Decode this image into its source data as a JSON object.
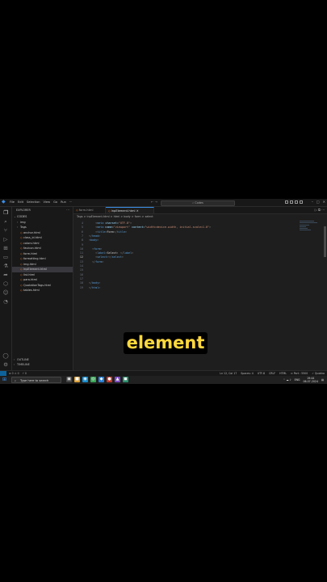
{
  "titlebar": {
    "menu": [
      "File",
      "Edit",
      "Selection",
      "View",
      "Go",
      "Run",
      "···"
    ],
    "search": "Codes",
    "nav": "← →"
  },
  "explorer": {
    "title": "EXPLORER",
    "root": "CODES",
    "items": [
      {
        "label": "img",
        "type": "folder",
        "indent": 1
      },
      {
        "label": "Tags",
        "type": "folder",
        "indent": 1
      },
      {
        "label": "anchor.html",
        "type": "file",
        "indent": 2
      },
      {
        "label": "class_id.html",
        "type": "file",
        "indent": 2
      },
      {
        "label": "colors.html",
        "type": "file",
        "indent": 2
      },
      {
        "label": "favicon.html",
        "type": "file",
        "indent": 2
      },
      {
        "label": "form.html",
        "type": "file",
        "indent": 2
      },
      {
        "label": "formatting.html",
        "type": "file",
        "indent": 2
      },
      {
        "label": "img.html",
        "type": "file",
        "indent": 2
      },
      {
        "label": "inpElement.html",
        "type": "file",
        "indent": 2,
        "selected": true
      },
      {
        "label": "list.html",
        "type": "file",
        "indent": 2
      },
      {
        "label": "para.html",
        "type": "file",
        "indent": 2
      },
      {
        "label": "QuotationTags.html",
        "type": "file",
        "indent": 2
      },
      {
        "label": "tables.html",
        "type": "file",
        "indent": 2
      }
    ],
    "outline": "OUTLINE",
    "timeline": "TIMELINE"
  },
  "tabs": [
    {
      "label": "form.html",
      "active": false
    },
    {
      "label": "inpElement.html",
      "active": true
    }
  ],
  "breadcrumb": "Tags > inpElement.html > html > body > form > select",
  "code_lines": [
    {
      "n": "4",
      "parts": [
        [
          "p",
          "    <"
        ],
        [
          "t",
          "meta"
        ],
        [
          "a",
          " charset"
        ],
        [
          "x",
          "="
        ],
        [
          "s",
          "\"UTF-8\""
        ],
        [
          "p",
          ">"
        ]
      ]
    },
    {
      "n": "5",
      "parts": [
        [
          "p",
          "    <"
        ],
        [
          "t",
          "meta"
        ],
        [
          "a",
          " name"
        ],
        [
          "x",
          "="
        ],
        [
          "s",
          "\"viewport\""
        ],
        [
          "a",
          " content"
        ],
        [
          "x",
          "="
        ],
        [
          "s",
          "\"width=device-width, initial-scale=1.0\""
        ],
        [
          "p",
          ">"
        ]
      ]
    },
    {
      "n": "6",
      "parts": [
        [
          "p",
          "    <"
        ],
        [
          "t",
          "title"
        ],
        [
          "p",
          ">"
        ],
        [
          "x",
          "Form"
        ],
        [
          "p",
          "</"
        ],
        [
          "t",
          "title"
        ],
        [
          "p",
          ">"
        ]
      ]
    },
    {
      "n": "7",
      "parts": [
        [
          "p",
          "</"
        ],
        [
          "t",
          "head"
        ],
        [
          "p",
          ">"
        ]
      ]
    },
    {
      "n": "8",
      "parts": [
        [
          "p",
          "<"
        ],
        [
          "t",
          "body"
        ],
        [
          "p",
          ">"
        ]
      ]
    },
    {
      "n": "9",
      "parts": [
        [
          "x",
          ""
        ]
      ]
    },
    {
      "n": "10",
      "parts": [
        [
          "p",
          "  <"
        ],
        [
          "t",
          "form"
        ],
        [
          "p",
          ">"
        ]
      ]
    },
    {
      "n": "11",
      "parts": [
        [
          "p",
          "    <"
        ],
        [
          "t",
          "label"
        ],
        [
          "p",
          ">"
        ],
        [
          "x",
          "Select: "
        ],
        [
          "p",
          "</"
        ],
        [
          "t",
          "label"
        ],
        [
          "p",
          ">"
        ]
      ]
    },
    {
      "n": "12",
      "parts": [
        [
          "p",
          "    <"
        ],
        [
          "t",
          "select"
        ],
        [
          "p",
          ">"
        ],
        [
          "x",
          ""
        ],
        [
          "p",
          "</"
        ],
        [
          "t",
          "select"
        ],
        [
          "p",
          ">"
        ]
      ],
      "current": true
    },
    {
      "n": "13",
      "parts": [
        [
          "p",
          "  </"
        ],
        [
          "t",
          "form"
        ],
        [
          "p",
          ">"
        ]
      ]
    },
    {
      "n": "14",
      "parts": [
        [
          "x",
          ""
        ]
      ]
    },
    {
      "n": "15",
      "parts": [
        [
          "x",
          ""
        ]
      ]
    },
    {
      "n": "16",
      "parts": [
        [
          "x",
          ""
        ]
      ]
    },
    {
      "n": "17",
      "parts": [
        [
          "x",
          ""
        ]
      ]
    },
    {
      "n": "18",
      "parts": [
        [
          "p",
          "</"
        ],
        [
          "t",
          "body"
        ],
        [
          "p",
          ">"
        ]
      ]
    },
    {
      "n": "19",
      "parts": [
        [
          "p",
          "</"
        ],
        [
          "t",
          "html"
        ],
        [
          "p",
          ">"
        ]
      ]
    }
  ],
  "statusbar": {
    "left": [
      "⊗ 0 ⚠ 0",
      "⚡ 0"
    ],
    "right": [
      "Ln 12, Col 17",
      "Spaces: 4",
      "UTF-8",
      "CRLF",
      "HTML",
      "⊙ Port : 5500",
      "✓ Quokka"
    ]
  },
  "taskbar": {
    "search_placeholder": "Type here to search",
    "apps": [
      {
        "icon": "task-view",
        "glyph": "▣",
        "color": "#444"
      },
      {
        "icon": "folder",
        "glyph": "■",
        "color": "#d9a03a"
      },
      {
        "icon": "edge",
        "glyph": "◉",
        "color": "#1a8fcf"
      },
      {
        "icon": "chrome",
        "glyph": "◎",
        "color": "#3aa757"
      },
      {
        "icon": "vscode",
        "glyph": "◆",
        "color": "#2b7fd1"
      },
      {
        "icon": "recorder",
        "glyph": "●",
        "color": "#c0392b"
      },
      {
        "icon": "app",
        "glyph": "▲",
        "color": "#7d4cc2"
      },
      {
        "icon": "app",
        "glyph": "◼",
        "color": "#2d8f6f"
      }
    ],
    "tray": [
      "ENG",
      "19:44",
      "06-07-2024"
    ]
  },
  "caption": "element",
  "colors": {
    "accent": "#3a8ee6",
    "caption_text": "#ffd83d",
    "caption_bg": "#000000"
  }
}
